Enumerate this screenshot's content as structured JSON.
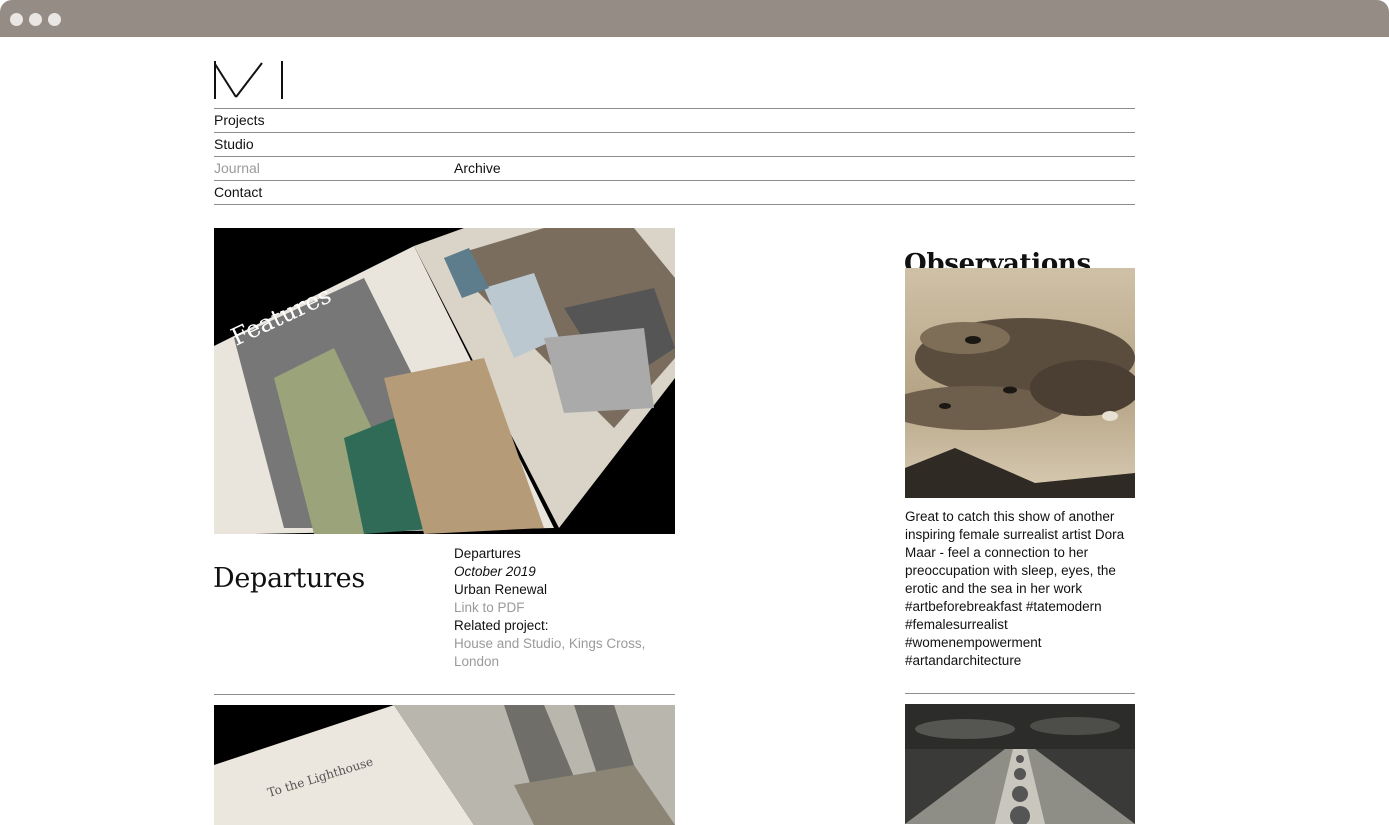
{
  "window": {
    "controls": [
      "close",
      "minimize",
      "maximize"
    ]
  },
  "logo": {
    "name": "studio-logo",
    "icon": "monogram-m-logo"
  },
  "nav": {
    "items": [
      {
        "label": "Projects",
        "sub": ""
      },
      {
        "label": "Studio",
        "sub": ""
      },
      {
        "label": "Journal",
        "sub": "Archive",
        "active": true
      },
      {
        "label": "Contact",
        "sub": ""
      }
    ]
  },
  "articles": [
    {
      "title": "Departures",
      "publication": "Departures",
      "date": "October 2019",
      "headline": "Urban Renewal",
      "link": "Link to PDF",
      "related_label": "Related project:",
      "related_project": "House and Studio, Kings Cross, London",
      "image": "magazine-features-spread"
    },
    {
      "image": "magazine-lighthouse-spread"
    }
  ],
  "observations": {
    "heading": "Observations",
    "posts": [
      {
        "image": "surrealist-sky-eyes-artwork",
        "text": "Great to catch this show of another inspiring female surrealist artist Dora Maar - feel a connection to her preoccupation with sleep, eyes, the erotic and the sea in her work",
        "tags": [
          "#artbeforebreakfast #tatemodern",
          "#femalesurrealist",
          "#womenempowerment",
          "#artandarchitecture"
        ]
      },
      {
        "image": "surrealist-chain-pier-artwork"
      }
    ]
  },
  "colors": {
    "chrome": "#958c85",
    "rule": "#8d8d8d",
    "muted": "#9a9a9a",
    "text": "#111111"
  }
}
